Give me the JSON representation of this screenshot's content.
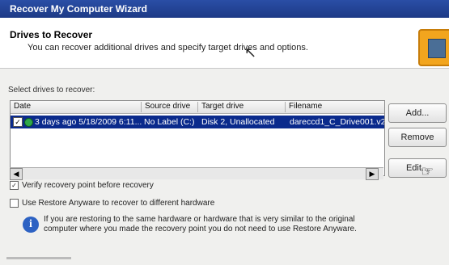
{
  "window": {
    "title": "Recover My Computer Wizard"
  },
  "header": {
    "title": "Drives to Recover",
    "subtitle": "You can recover additional drives and specify target drives and options."
  },
  "list": {
    "label": "Select drives to recover:",
    "columns": [
      "Date",
      "Source drive",
      "Target drive",
      "Filename"
    ],
    "rows": [
      {
        "checked": true,
        "date": "3 days ago 5/18/2009 6:11...",
        "source": "No Label (C:)",
        "target": "Disk 2, Unallocated",
        "filename": "dareccd1_C_Drive001.v2"
      }
    ]
  },
  "buttons": {
    "add": "Add...",
    "remove": "Remove",
    "edit": "Edit..."
  },
  "options": {
    "verify": {
      "label": "Verify recovery point before recovery",
      "checked": true
    },
    "restore_anyware": {
      "label": "Use Restore Anyware to recover to different hardware",
      "checked": false
    }
  },
  "info": {
    "text": "If you are restoring to the same hardware or hardware that is very similar to the original computer where you made the recovery point you do not need to use Restore Anyware."
  },
  "icons": {
    "info": "info-icon",
    "logo": "computer-recovery-logo",
    "cursor": "mouse-cursor-icon"
  }
}
